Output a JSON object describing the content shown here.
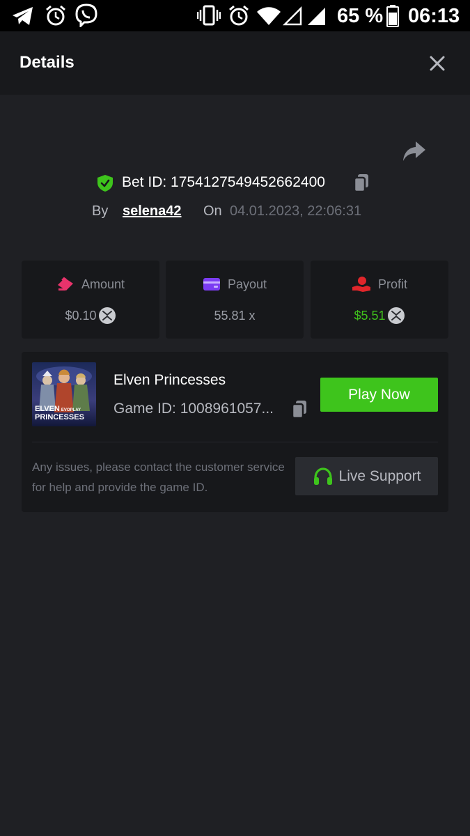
{
  "status_bar": {
    "battery_text": "65 %",
    "time": "06:13",
    "icons": [
      "telegram-icon",
      "alarm-icon",
      "viber-icon",
      "vibrate-icon",
      "alarm-icon",
      "wifi-icon",
      "signal-empty-icon",
      "signal-icon",
      "battery-icon"
    ]
  },
  "header": {
    "title": "Details",
    "close_icon": "close-icon"
  },
  "bet": {
    "id_label": "Bet ID: 1754127549452662400",
    "by_label": "By",
    "user": "selena42",
    "on_label": "On",
    "date": "04.01.2023, 22:06:31"
  },
  "stats": [
    {
      "title": "Amount",
      "value": "$0.10",
      "icon": "amount-icon",
      "icon_color": "#e8336b",
      "has_coin": true,
      "value_color": "#9a9da5"
    },
    {
      "title": "Payout",
      "value": "55.81 x",
      "icon": "wallet-icon",
      "icon_color": "#7b3cf2",
      "has_coin": false,
      "value_color": "#9a9da5"
    },
    {
      "title": "Profit",
      "value": "$5.51",
      "icon": "profit-hand-icon",
      "icon_color": "#e0262b",
      "has_coin": true,
      "value_color": "#3fc01c"
    }
  ],
  "game": {
    "name": "Elven Princesses",
    "id_label": "Game ID: 1008961057...",
    "thumb_title_1": "ELVEN",
    "thumb_brand": "EVOPLAY",
    "thumb_title_2": "PRINCESSES",
    "play_label": "Play Now",
    "support_text": "Any issues, please contact the customer service for help and provide the game ID.",
    "support_label": "Live Support"
  },
  "colors": {
    "background": "#1f2024",
    "card": "#17181b",
    "accent_green": "#3ec41c",
    "shield_green": "#3ec41c",
    "support_green": "#3ec41c"
  }
}
